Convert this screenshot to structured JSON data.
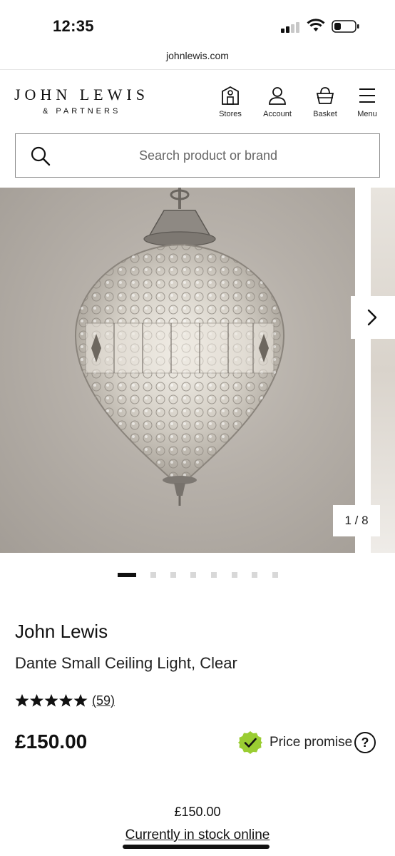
{
  "status_bar": {
    "time": "12:35"
  },
  "browser": {
    "url": "johnlewis.com"
  },
  "header": {
    "logo_main": "JOHN LEWIS",
    "logo_sub": "& PARTNERS",
    "nav": [
      {
        "label": "Stores",
        "icon": "store-icon"
      },
      {
        "label": "Account",
        "icon": "account-icon"
      },
      {
        "label": "Basket",
        "icon": "basket-icon"
      },
      {
        "label": "Menu",
        "icon": "menu-icon"
      }
    ]
  },
  "search": {
    "placeholder": "Search product or brand"
  },
  "gallery": {
    "counter": "1 / 8",
    "total_images": 8,
    "active_index": 0
  },
  "product": {
    "brand": "John Lewis",
    "title": "Dante Small Ceiling Light, Clear",
    "rating_stars": 5,
    "review_count": "(59)",
    "price": "£150.00",
    "price_promise_label": "Price promise",
    "price_promise_help": "?"
  },
  "purchase_bar": {
    "price": "£150.00",
    "stock_status": "Currently in stock online"
  },
  "colors": {
    "accent_green": "#9acd32",
    "text_primary": "#111111"
  }
}
